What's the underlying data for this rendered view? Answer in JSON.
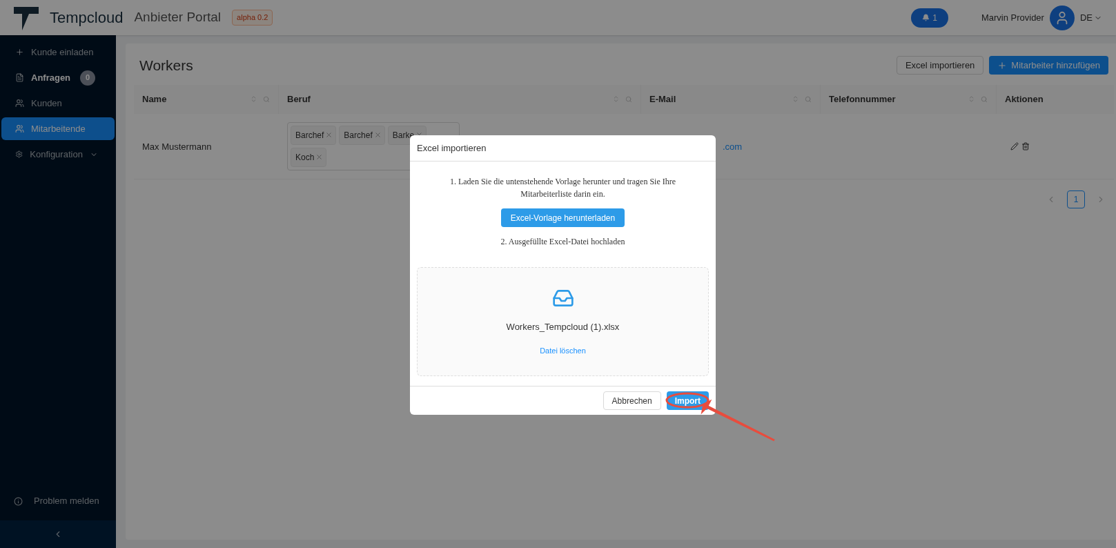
{
  "header": {
    "brand": "Tempcloud",
    "portal": "Anbieter Portal",
    "version_badge": "alpha 0.2",
    "notifications": "1",
    "user_name": "Marvin Provider",
    "language": "DE"
  },
  "sidebar": {
    "items": [
      {
        "kind": "plus",
        "label": "Kunde einladen",
        "selected": false
      },
      {
        "kind": "file",
        "label": "Anfragen",
        "count": "0",
        "selected": false
      },
      {
        "kind": "users",
        "label": "Kunden",
        "selected": false
      },
      {
        "kind": "team",
        "label": "Mitarbeitende",
        "selected": true
      },
      {
        "kind": "gear",
        "label": "Konfiguration",
        "selected": false,
        "expanded": false
      }
    ],
    "footer": "Problem melden"
  },
  "page": {
    "title": "Workers",
    "buttons": [
      {
        "kind": "default",
        "label": "Excel importieren"
      },
      {
        "kind": "primary",
        "label": "Mitarbeiter hinzufügen"
      }
    ]
  },
  "table": {
    "columns": [
      {
        "label": "Name",
        "sortable": true
      },
      {
        "label": "Beruf",
        "sortable": true
      },
      {
        "label": "E-Mail",
        "sortable": true
      },
      {
        "label": "Telefonnummer",
        "sortable": true
      },
      {
        "label": "Aktionen",
        "sortable": false
      }
    ],
    "rows": [
      {
        "name": "Max Mustermann",
        "tags": [
          "Barchef",
          "Barchef",
          "Barke",
          "Koch"
        ],
        "email": ".com"
      }
    ]
  },
  "pagination": {
    "pages": [
      {
        "label": "1",
        "selected": true
      }
    ]
  },
  "modal": {
    "title": "Excel importieren",
    "step_1": "1. Laden Sie die untenstehende Vorlage herunter und tragen Sie Ihre Mitarbeiterliste darin ein.",
    "download_button": "Excel-Vorlage herunterladen",
    "step_2": "2. Ausgefüllte Excel-Datei hochladen",
    "file_name": "Workers_Tempcloud (1).xlsx",
    "delete_link": "Datei löschen",
    "cancel_button": "Abbrechen",
    "import_button": "Import"
  }
}
